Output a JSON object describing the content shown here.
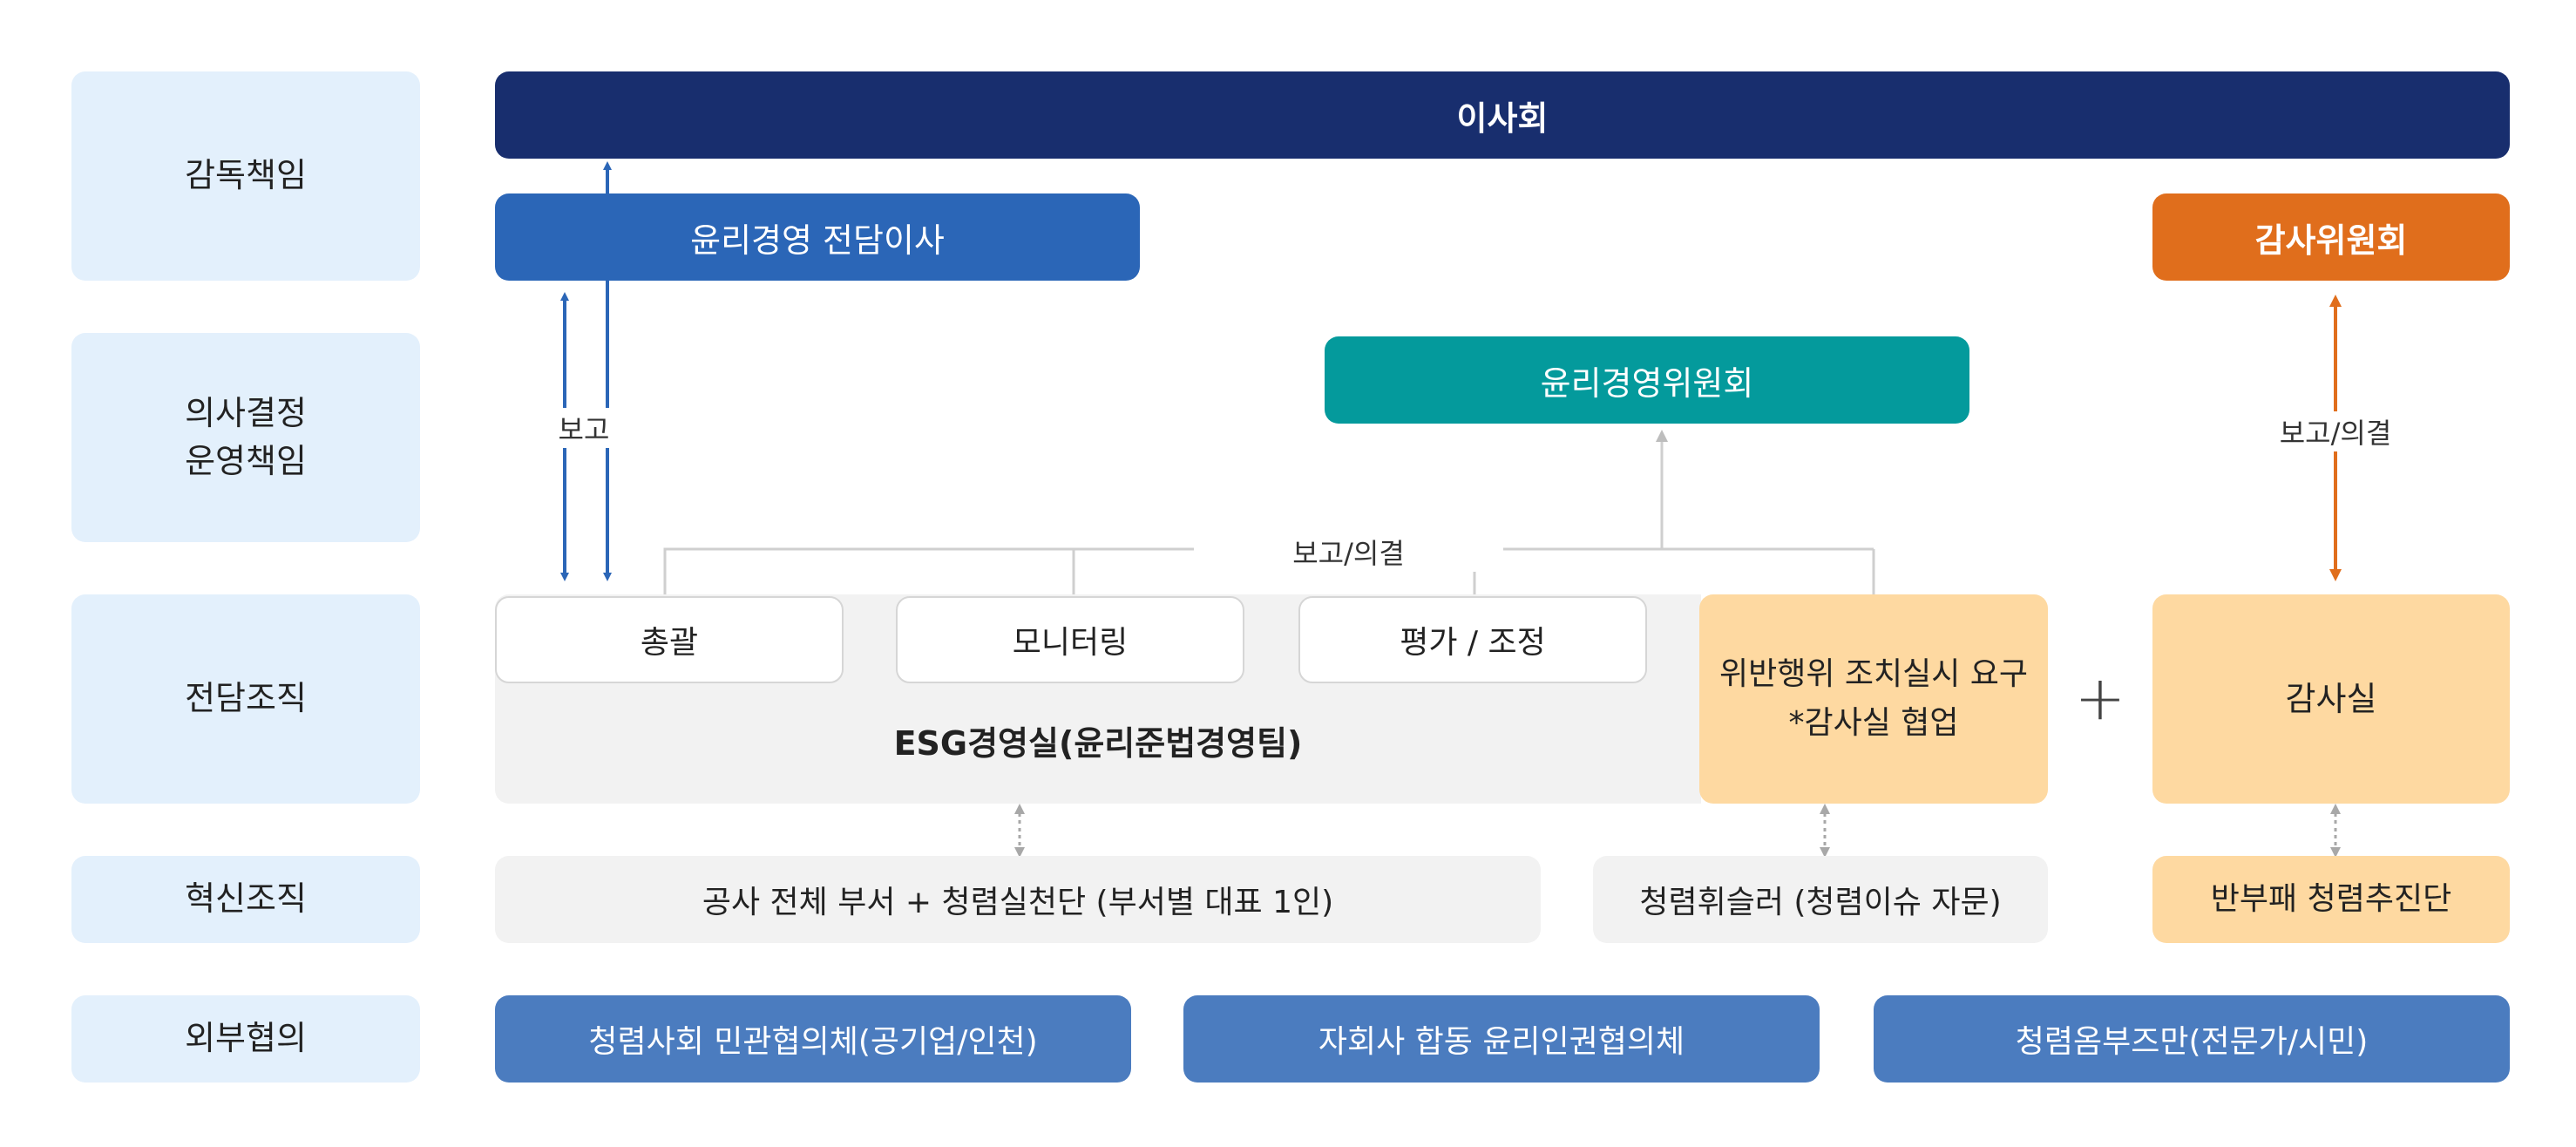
{
  "rows": {
    "oversight": "감독책임",
    "decision": "의사결정\n운영책임",
    "dedicated": "전담조직",
    "innovation": "혁신조직",
    "external": "외부협의"
  },
  "board": "이사회",
  "ethics_director": "윤리경영 전담이사",
  "audit_committee": "감사위원회",
  "ethics_committee": "윤리경영위원회",
  "edges": {
    "report": "보고",
    "report_resolve_center": "보고/의결",
    "report_resolve_right": "보고/의결"
  },
  "units": {
    "general": "총괄",
    "monitoring": "모니터링",
    "evaluation": "평가 / 조정",
    "violation": "위반행위 조치실시 요구\n*감사실 협업",
    "esg_office": "ESG경영실(윤리준법경영팀)",
    "audit_office": "감사실",
    "plus": "+"
  },
  "innovation": {
    "all_depts": "공사 전체 부서 + 청렴실천단 (부서별 대표 1인)",
    "whistler": "청렴휘슬러 (청렴이슈 자문)",
    "anticorruption": "반부패 청렴추진단"
  },
  "external": {
    "council": "청렴사회 민관협의체(공기업/인천)",
    "affiliates": "자회사 합동 윤리인권협의체",
    "ombudsman": "청렴옴부즈만(전문가/시민)"
  },
  "colors": {
    "navy": "#182e6e",
    "blue": "#2b66b7",
    "teal": "#049a9c",
    "orange": "#e06e1c",
    "peach": "#fed9a1",
    "light_blue_label": "#e3f0fc",
    "external_blue": "#4b7cbf"
  }
}
